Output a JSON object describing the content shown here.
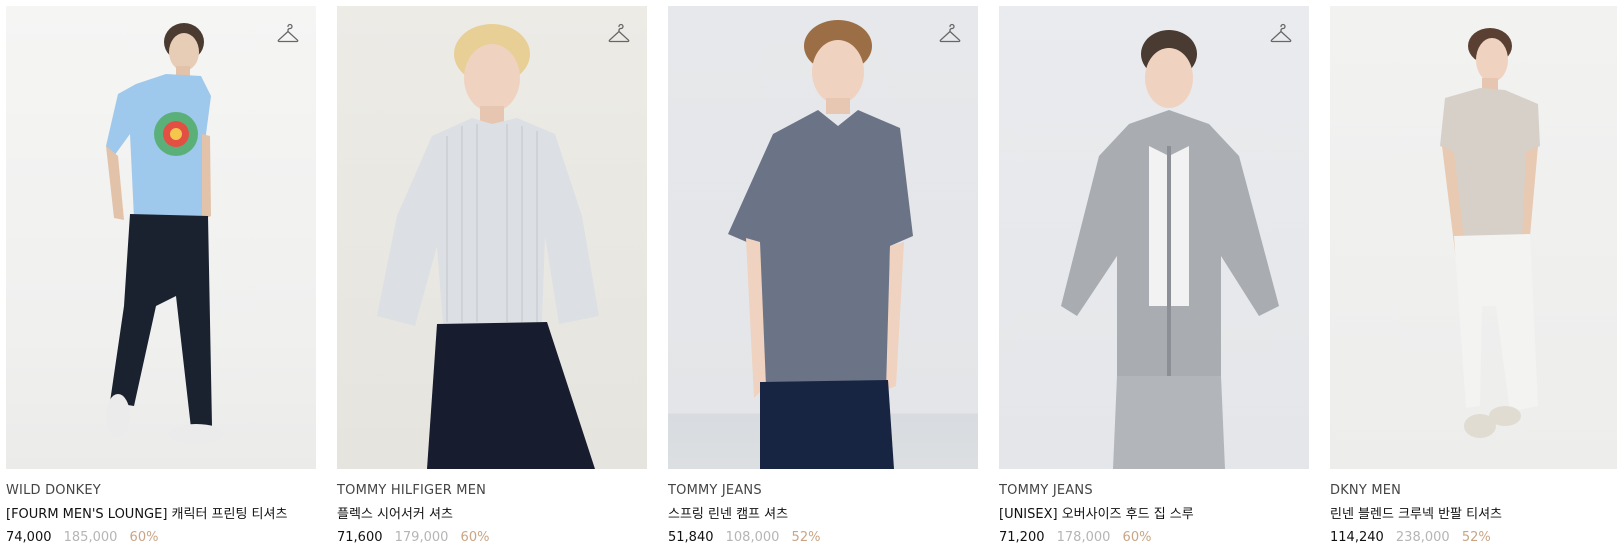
{
  "products": [
    {
      "brand": "WILD DONKEY",
      "name": "[FOURM MEN'S LOUNGE] 캐릭터 프린팅 티셔츠",
      "price": "74,000",
      "original_price": "185,000",
      "discount": "60%",
      "wishlist_icon": "hanger-icon"
    },
    {
      "brand": "TOMMY HILFIGER MEN",
      "name": "플렉스 시어서커 셔츠",
      "price": "71,600",
      "original_price": "179,000",
      "discount": "60%",
      "wishlist_icon": "hanger-icon"
    },
    {
      "brand": "TOMMY JEANS",
      "name": "스프링 린넨 캠프 셔츠",
      "price": "51,840",
      "original_price": "108,000",
      "discount": "52%",
      "wishlist_icon": "hanger-icon"
    },
    {
      "brand": "TOMMY JEANS",
      "name": "[UNISEX] 오버사이즈 후드 집 스루",
      "price": "71,200",
      "original_price": "178,000",
      "discount": "60%",
      "wishlist_icon": "hanger-icon"
    },
    {
      "brand": "DKNY MEN",
      "name": "린넨 블렌드 크루넥 반팔 티셔츠",
      "price": "114,240",
      "original_price": "238,000",
      "discount": "52%",
      "wishlist_icon": "hanger-icon"
    }
  ],
  "colors": {
    "discount": "#c9a585",
    "original_price": "#b5b5b5",
    "price": "#111111"
  }
}
